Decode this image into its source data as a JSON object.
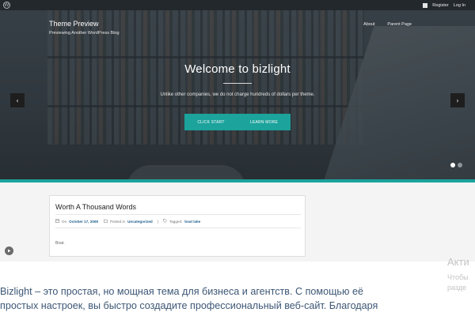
{
  "admin_bar": {
    "register_label": "Register",
    "login_label": "Log In"
  },
  "site": {
    "title": "Theme Preview",
    "description": "Previewing Another WordPress Blog",
    "nav": [
      "About",
      "Parent Page"
    ]
  },
  "hero": {
    "title": "Welcome to bizlight",
    "subtitle": "Unlike other companies, we do not charge hundreds of dollars per theme.",
    "buttons": [
      "CLICK START",
      "LEARN MORE"
    ],
    "slides_total": 2,
    "active_slide": 1
  },
  "post": {
    "title": "Worth A Thousand Words",
    "meta_on": "On",
    "date": "October 17, 2008",
    "meta_posted_in": "Posted in",
    "category": "Uncategorized",
    "meta_sep": "|",
    "meta_tagged": "Tagged:",
    "tag": "boat lake",
    "excerpt": "Boat."
  },
  "watermark": {
    "title": "Акти",
    "line1": "Чтобы",
    "line2": "разде"
  },
  "description": {
    "line1": "Bizlight – это простая, но мощная тема для бизнеса и агентств. С помощью её",
    "line2": "простых настроек, вы быстро создадите профессиональный веб-сайт. Благодаря"
  },
  "colors": {
    "accent": "#1ba39c",
    "admin_bar": "#23282d",
    "link": "#1f5f8b"
  },
  "icons": {
    "wp_logo": "wordpress-icon",
    "prev": "chevron-left-icon",
    "next": "chevron-right-icon",
    "play": "play-icon"
  }
}
